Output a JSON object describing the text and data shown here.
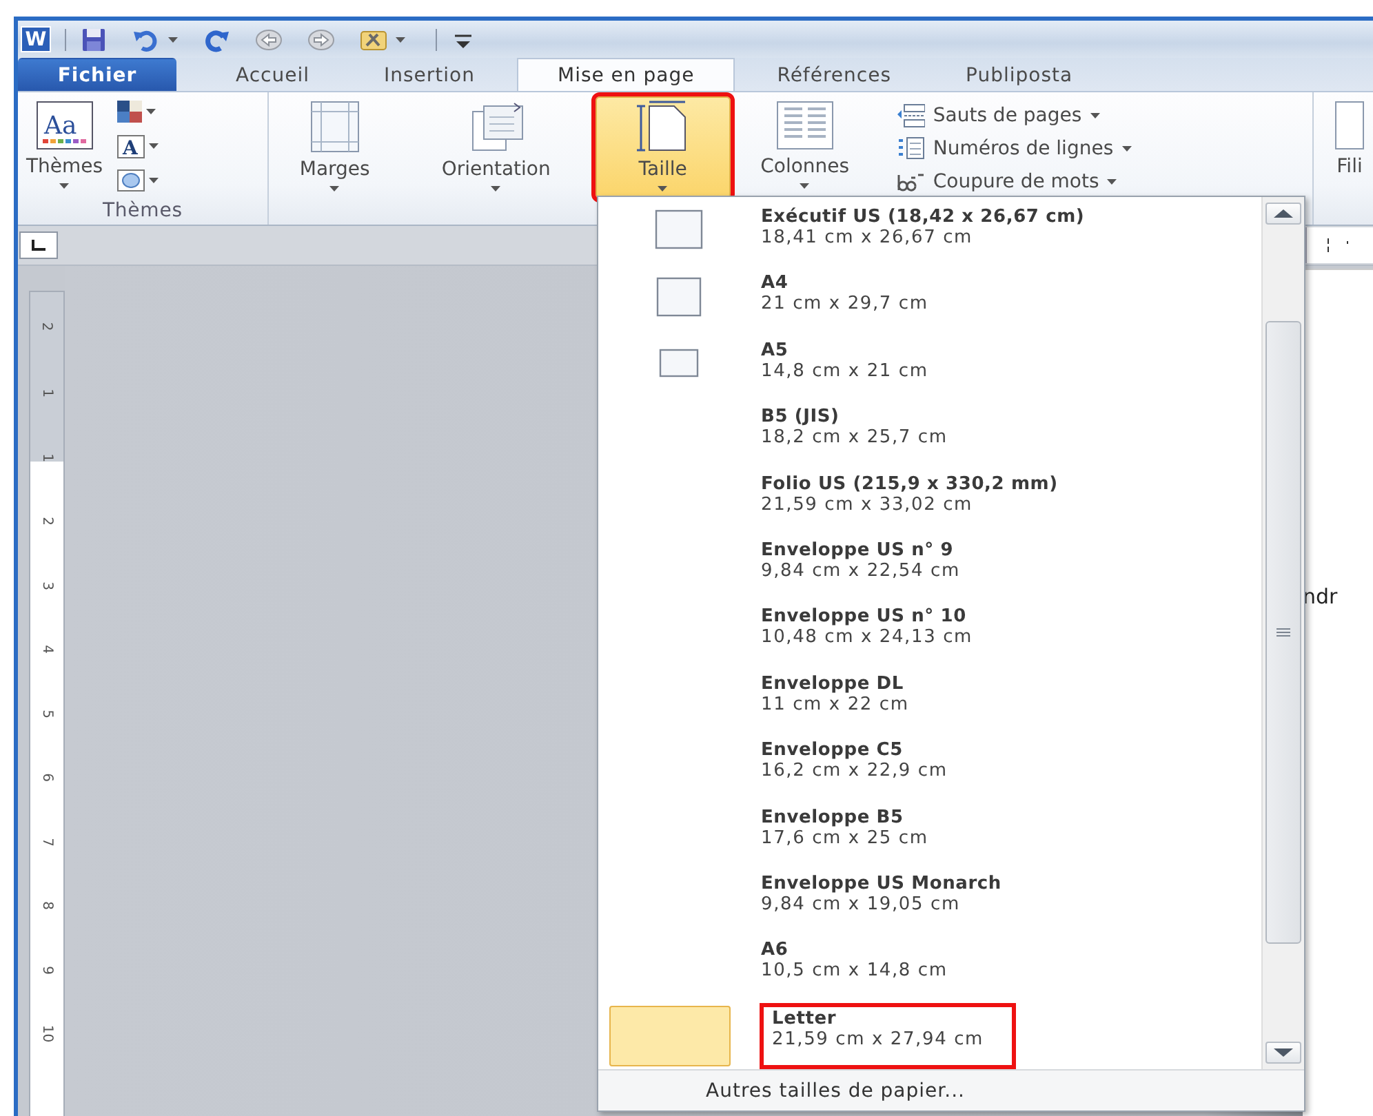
{
  "title_bar": {
    "logo_letter": "W",
    "quick_access": [
      {
        "kind": "save",
        "dropdown": false
      },
      {
        "kind": "undo",
        "dropdown": true
      },
      {
        "kind": "redo",
        "dropdown": false
      },
      {
        "kind": "back",
        "dropdown": false
      },
      {
        "kind": "forward",
        "dropdown": false
      },
      {
        "kind": "tools",
        "dropdown": true
      },
      {
        "kind": "customize",
        "dropdown": false
      }
    ]
  },
  "tabs": [
    {
      "label": "Fichier",
      "kind": "file",
      "selected": false
    },
    {
      "label": "Accueil",
      "kind": "tab",
      "selected": false
    },
    {
      "label": "Insertion",
      "kind": "tab",
      "selected": false
    },
    {
      "label": "Mise en page",
      "kind": "tab",
      "selected": true
    },
    {
      "label": "Références",
      "kind": "tab",
      "selected": false
    },
    {
      "label": "Publiposta",
      "kind": "tab",
      "selected": false
    }
  ],
  "ribbon": {
    "groups": [
      {
        "label": "Thèmes",
        "buttons": [
          {
            "kind": "large",
            "icon_text": "Aa",
            "label": "Thèmes",
            "dropdown": true,
            "pressed": false,
            "annotated": false
          },
          {
            "kind": "small",
            "dropdown": true
          },
          {
            "kind": "small",
            "icon_text": "A",
            "dropdown": true
          },
          {
            "kind": "small",
            "dropdown": true
          }
        ]
      },
      {
        "buttons": [
          {
            "kind": "large",
            "label": "Marges",
            "dropdown": true,
            "pressed": false,
            "annotated": false
          },
          {
            "kind": "large",
            "label": "Orientation",
            "dropdown": true,
            "pressed": false,
            "annotated": false
          },
          {
            "kind": "large",
            "label": "Taille",
            "dropdown": true,
            "pressed": true,
            "annotated": true
          },
          {
            "kind": "large",
            "label": "Colonnes",
            "dropdown": true,
            "pressed": false,
            "annotated": false
          },
          {
            "kind": "row",
            "label": "Sauts de pages",
            "dropdown": true
          },
          {
            "kind": "row",
            "label": "Numéros de lignes",
            "dropdown": true
          },
          {
            "kind": "row",
            "label": "Coupure de mots",
            "dropdown": true
          }
        ]
      },
      {
        "buttons": [
          {
            "kind": "large",
            "label": "Fili",
            "dropdown": false,
            "pressed": false,
            "annotated": false
          }
        ]
      }
    ]
  },
  "document": {
    "visible_text": "ndr",
    "vertical_ruler": [
      "2",
      "1",
      "1",
      "2",
      "3",
      "4",
      "5",
      "6",
      "7",
      "8",
      "9",
      "10"
    ]
  },
  "size_menu": {
    "items": [
      {
        "name": "Exécutif US (18,42 x 26,67 cm)",
        "size": "18,41 cm x 26,67 cm",
        "kind": "with-icon",
        "selected": false,
        "annotated": false
      },
      {
        "name": "A4",
        "size": "21 cm x 29,7 cm",
        "kind": "with-icon",
        "selected": false,
        "annotated": false
      },
      {
        "name": "A5",
        "size": "14,8 cm x 21 cm",
        "kind": "with-icon",
        "selected": false,
        "annotated": false
      },
      {
        "name": "B5 (JIS)",
        "size": "18,2 cm x 25,7 cm",
        "kind": "text",
        "selected": false,
        "annotated": false
      },
      {
        "name": "Folio US (215,9 x 330,2 mm)",
        "size": "21,59 cm x 33,02 cm",
        "kind": "text",
        "selected": false,
        "annotated": false
      },
      {
        "name": "Enveloppe US n° 9",
        "size": "9,84 cm x 22,54 cm",
        "kind": "text",
        "selected": false,
        "annotated": false
      },
      {
        "name": "Enveloppe US n° 10",
        "size": "10,48 cm x 24,13 cm",
        "kind": "text",
        "selected": false,
        "annotated": false
      },
      {
        "name": "Enveloppe DL",
        "size": "11 cm x 22 cm",
        "kind": "text",
        "selected": false,
        "annotated": false
      },
      {
        "name": "Enveloppe C5",
        "size": "16,2 cm x 22,9 cm",
        "kind": "text",
        "selected": false,
        "annotated": false
      },
      {
        "name": "Enveloppe B5",
        "size": "17,6 cm x 25 cm",
        "kind": "text",
        "selected": false,
        "annotated": false
      },
      {
        "name": "Enveloppe US Monarch",
        "size": "9,84 cm x 19,05 cm",
        "kind": "text",
        "selected": false,
        "annotated": false
      },
      {
        "name": "A6",
        "size": "10,5 cm x 14,8 cm",
        "kind": "text",
        "selected": false,
        "annotated": false
      },
      {
        "name": "Letter",
        "size": "21,59 cm x 27,94 cm",
        "kind": "text",
        "selected": true,
        "annotated": true
      }
    ],
    "footer": "Autres tailles de papier..."
  }
}
